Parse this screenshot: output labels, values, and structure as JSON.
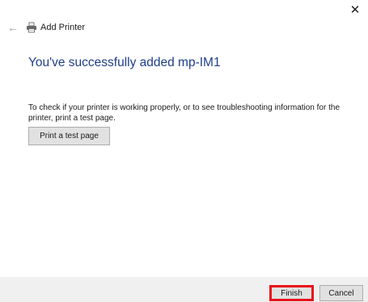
{
  "window": {
    "title": "Add Printer",
    "close_glyph": "✕",
    "back_glyph": "←"
  },
  "main": {
    "headline": "You've successfully added mp-IM1",
    "description": "To check if your printer is working properly, or to see troubleshooting information for the printer, print a test page.",
    "test_page_label": "Print a test page"
  },
  "footer": {
    "finish_label": "Finish",
    "cancel_label": "Cancel"
  },
  "colors": {
    "headline": "#1e3f8a",
    "highlight_border": "#e8111b",
    "footer_bg": "#f0f0f0",
    "button_bg": "#e1e1e1"
  },
  "icons": {
    "back": "back-arrow-icon",
    "printer": "printer-icon",
    "close": "close-icon"
  }
}
